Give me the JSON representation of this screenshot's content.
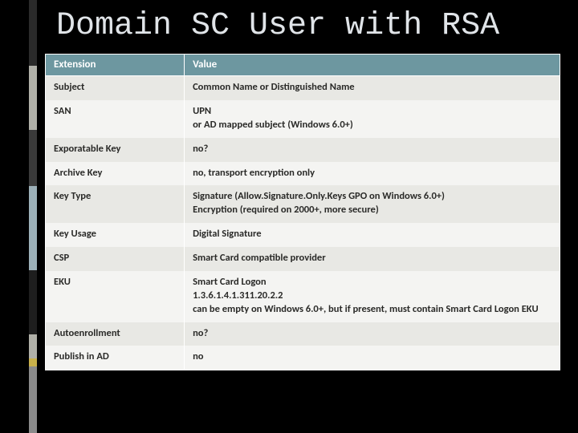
{
  "title": "Domain SC User with RSA",
  "table": {
    "headers": [
      "Extension",
      "Value"
    ],
    "rows": [
      {
        "ext": "Subject",
        "val": "Common Name or Distinguished Name"
      },
      {
        "ext": "SAN",
        "val": "UPN\nor AD mapped subject (Windows 6.0+)"
      },
      {
        "ext": "Exporatable Key",
        "val": "no?"
      },
      {
        "ext": "Archive Key",
        "val": "no, transport encryption only"
      },
      {
        "ext": "Key Type",
        "val": "Signature (Allow.Signature.Only.Keys GPO on Windows 6.0+)\nEncryption (required on 2000+, more secure)"
      },
      {
        "ext": "Key Usage",
        "val": "Digital Signature"
      },
      {
        "ext": "CSP",
        "val": "Smart Card compatible provider"
      },
      {
        "ext": "EKU",
        "val": "Smart Card Logon\n1.3.6.1.4.1.311.20.2.2\ncan be empty on Windows 6.0+, but if present, must contain Smart Card Logon EKU"
      },
      {
        "ext": "Autoenrollment",
        "val": "no?"
      },
      {
        "ext": "Publish in AD",
        "val": "no"
      }
    ]
  }
}
